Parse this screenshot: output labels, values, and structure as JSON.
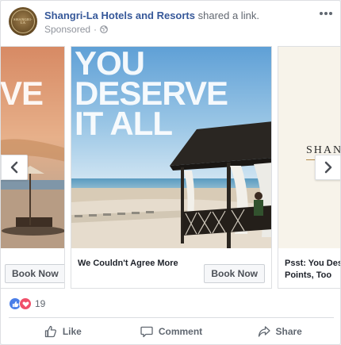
{
  "post": {
    "page_name": "Shangri-La Hotels and Resorts",
    "action_text": "shared a link.",
    "sponsored": "Sponsored",
    "avatar_text": "SHANGRI-LA"
  },
  "carousel": {
    "cards": [
      {
        "headline_fragment": "VE",
        "button_label": "Book Now",
        "title": ""
      },
      {
        "headline": "YOU DESERVE IT ALL",
        "headline_lines": [
          "YOU",
          "DESERVE",
          "IT ALL"
        ],
        "title": "We Couldn't Agree More",
        "button_label": "Book Now"
      },
      {
        "brand_text": "SHANG",
        "title": "Psst: You Deserve Points, Too",
        "title_lines": [
          "Psst: You Dese",
          "Points, Too"
        ]
      }
    ]
  },
  "reactions": {
    "count": "19",
    "types": [
      "like",
      "love"
    ]
  },
  "actions": [
    {
      "label": "Like",
      "icon": "thumbs-up-icon"
    },
    {
      "label": "Comment",
      "icon": "comment-icon"
    },
    {
      "label": "Share",
      "icon": "share-icon"
    }
  ],
  "colors": {
    "link": "#365899",
    "meta": "#90949c",
    "like_blue": "#4a7ee8",
    "love_red": "#f0506a"
  }
}
